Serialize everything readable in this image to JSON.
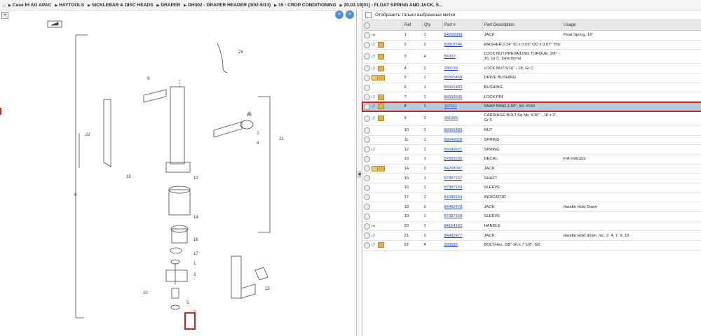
{
  "breadcrumb": [
    "Case IH AG APAC",
    "HAYTOOLS",
    "SICKLEBAR & DISC HEADS",
    "DRAPER",
    "DH302 - DRAPER HEADER (3/02-9/13)",
    "15 - CROP CONDITIONING",
    "20.03.19[01] - FLOAT SPRING AND JACK, S..."
  ],
  "nav": {
    "back": "<",
    "forward": ">"
  },
  "filter_label": "Отобразить только выбранные метки",
  "columns": {
    "ref": "Ref",
    "qty": "Qty",
    "part": "Part #",
    "desc": "Part Description",
    "usage": "Usage"
  },
  "rows": [
    {
      "ref": "1",
      "qty": "1",
      "part": "84268099",
      "desc": "JACK",
      "usage": "Float Spring, 16\"",
      "icons": [
        "green"
      ]
    },
    {
      "ref": "2",
      "qty": "2",
      "part": "83918746",
      "desc": "WASHER,0.34\" ID x 0.69\" OD x 0.07\" Thic",
      "usage": "",
      "icons": [
        "blue",
        "box"
      ]
    },
    {
      "ref": "3",
      "qty": "4",
      "part": "86902",
      "desc": "LOCK NUT,PREVAILING TORQUE, 3/8\" - 16, Gr C, Directional",
      "usage": "",
      "icons": [
        "blue",
        "box"
      ],
      "tall": true
    },
    {
      "ref": "4",
      "qty": "2",
      "part": "280739",
      "desc": "LOCK NUT,5/16\" - 18, Gr C",
      "usage": "",
      "icons": [
        "blue",
        "box"
      ]
    },
    {
      "ref": "5",
      "qty": "1",
      "part": "86565458",
      "desc": "DRIVE BUSHING",
      "usage": "",
      "icons": [
        "doc",
        "box"
      ]
    },
    {
      "ref": "6",
      "qty": "1",
      "part": "86565483",
      "desc": "BUSHING",
      "usage": "",
      "icons": []
    },
    {
      "ref": "7",
      "qty": "1",
      "part": "86559645",
      "desc": "LOCK PIN",
      "usage": "",
      "icons": [
        "blue",
        "box"
      ]
    },
    {
      "ref": "8",
      "qty": "1",
      "part": "167111",
      "desc": "SNAP RING,1.50\", Int, #150",
      "usage": "",
      "icons": [
        "blue",
        "box"
      ],
      "selected": true
    },
    {
      "ref": "9",
      "qty": "2",
      "part": "281096",
      "desc": "CARRIAGE BOLT,Sq Nk, 5/16\" - 18 x 3\", Gr 5",
      "usage": "",
      "icons": [
        "blue",
        "box"
      ],
      "tall": true
    },
    {
      "ref": "10",
      "qty": "1",
      "part": "86565489",
      "desc": "NUT",
      "usage": "",
      "icons": []
    },
    {
      "ref": "11",
      "qty": "1",
      "part": "86649620",
      "desc": "SPRING",
      "usage": "",
      "icons": []
    },
    {
      "ref": "12",
      "qty": "1",
      "part": "86649621",
      "desc": "SPRING",
      "usage": "",
      "icons": [
        "blue"
      ]
    },
    {
      "ref": "13",
      "qty": "1",
      "part": "87829232",
      "desc": "DECAL",
      "usage": "F/A Indicator",
      "icons": []
    },
    {
      "ref": "14",
      "qty": "1",
      "part": "84268097",
      "desc": "JACK",
      "usage": "",
      "icons": [
        "doc",
        "box"
      ]
    },
    {
      "ref": "15",
      "qty": "1",
      "part": "87387157",
      "desc": "SHAFT",
      "usage": "",
      "icons": []
    },
    {
      "ref": "16",
      "qty": "1",
      "part": "87387159",
      "desc": "SLEEVE",
      "usage": "",
      "icons": []
    },
    {
      "ref": "17",
      "qty": "1",
      "part": "84288154",
      "desc": "INDICATOR",
      "usage": "",
      "icons": []
    },
    {
      "ref": "18",
      "qty": "2",
      "part": "84492478",
      "desc": "JACK",
      "usage": "Handle Hold Down",
      "icons": []
    },
    {
      "ref": "19",
      "qty": "1",
      "part": "87387158",
      "desc": "SLEEVE",
      "usage": "",
      "icons": []
    },
    {
      "ref": "20",
      "qty": "1",
      "part": "84154162",
      "desc": "HANDLE",
      "usage": "",
      "icons": [
        "green"
      ]
    },
    {
      "ref": "21",
      "qty": "1",
      "part": "84492477",
      "desc": "JACK",
      "usage": "Handle Hold down, Inc. 2, 4, 7, 9, 18",
      "icons": [
        "blue"
      ]
    },
    {
      "ref": "22",
      "qty": "4",
      "part": "280585",
      "desc": "BOLT,Hex, 3/8\"-16 x 7 1/2\", G5",
      "usage": "",
      "icons": [
        "blue",
        "box"
      ]
    }
  ],
  "diagram_labels": [
    "24",
    "9",
    "19",
    "2",
    "4",
    "21",
    "22",
    "18",
    "13",
    "14",
    "16",
    "17",
    "10",
    "15",
    "5",
    "6",
    "1",
    "3",
    "7",
    "8"
  ],
  "colors": {
    "selected_row": "#b7ccdc",
    "highlight": "#d42020",
    "link": "#1a3fd6"
  }
}
